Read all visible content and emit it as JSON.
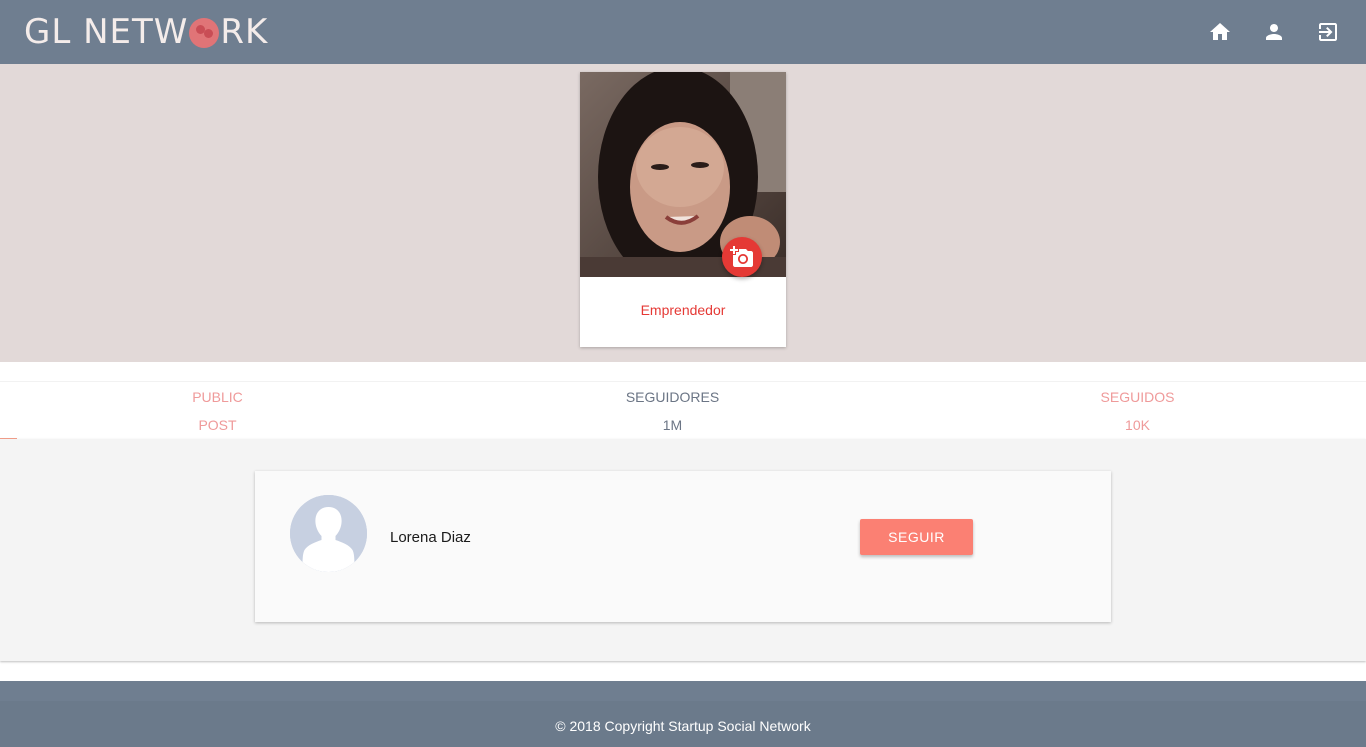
{
  "header": {
    "logo_text_left": "GL NETW",
    "logo_text_right": "RK",
    "nav": {
      "home_icon": "home-icon",
      "profile_icon": "person-icon",
      "logout_icon": "exit-icon"
    }
  },
  "profile": {
    "role": "Emprendedor",
    "camera_icon": "add-photo-icon"
  },
  "stats": {
    "posts": {
      "line1": "PUBLIC",
      "line2": "POST"
    },
    "followers": {
      "line1": "SEGUIDORES",
      "line2": "1M"
    },
    "following": {
      "line1": "SEGUIDOS",
      "line2": "10K"
    }
  },
  "follow_list": [
    {
      "name": "Lorena Diaz",
      "action": "SEGUIR"
    }
  ],
  "footer": {
    "copyright": "© 2018 Copyright Startup Social Network"
  },
  "colors": {
    "topbar": "#6f7e90",
    "banner": "#e2d9d8",
    "accent": "#e53935",
    "button": "#fb8073",
    "tab_pink": "#ef9a9a"
  }
}
